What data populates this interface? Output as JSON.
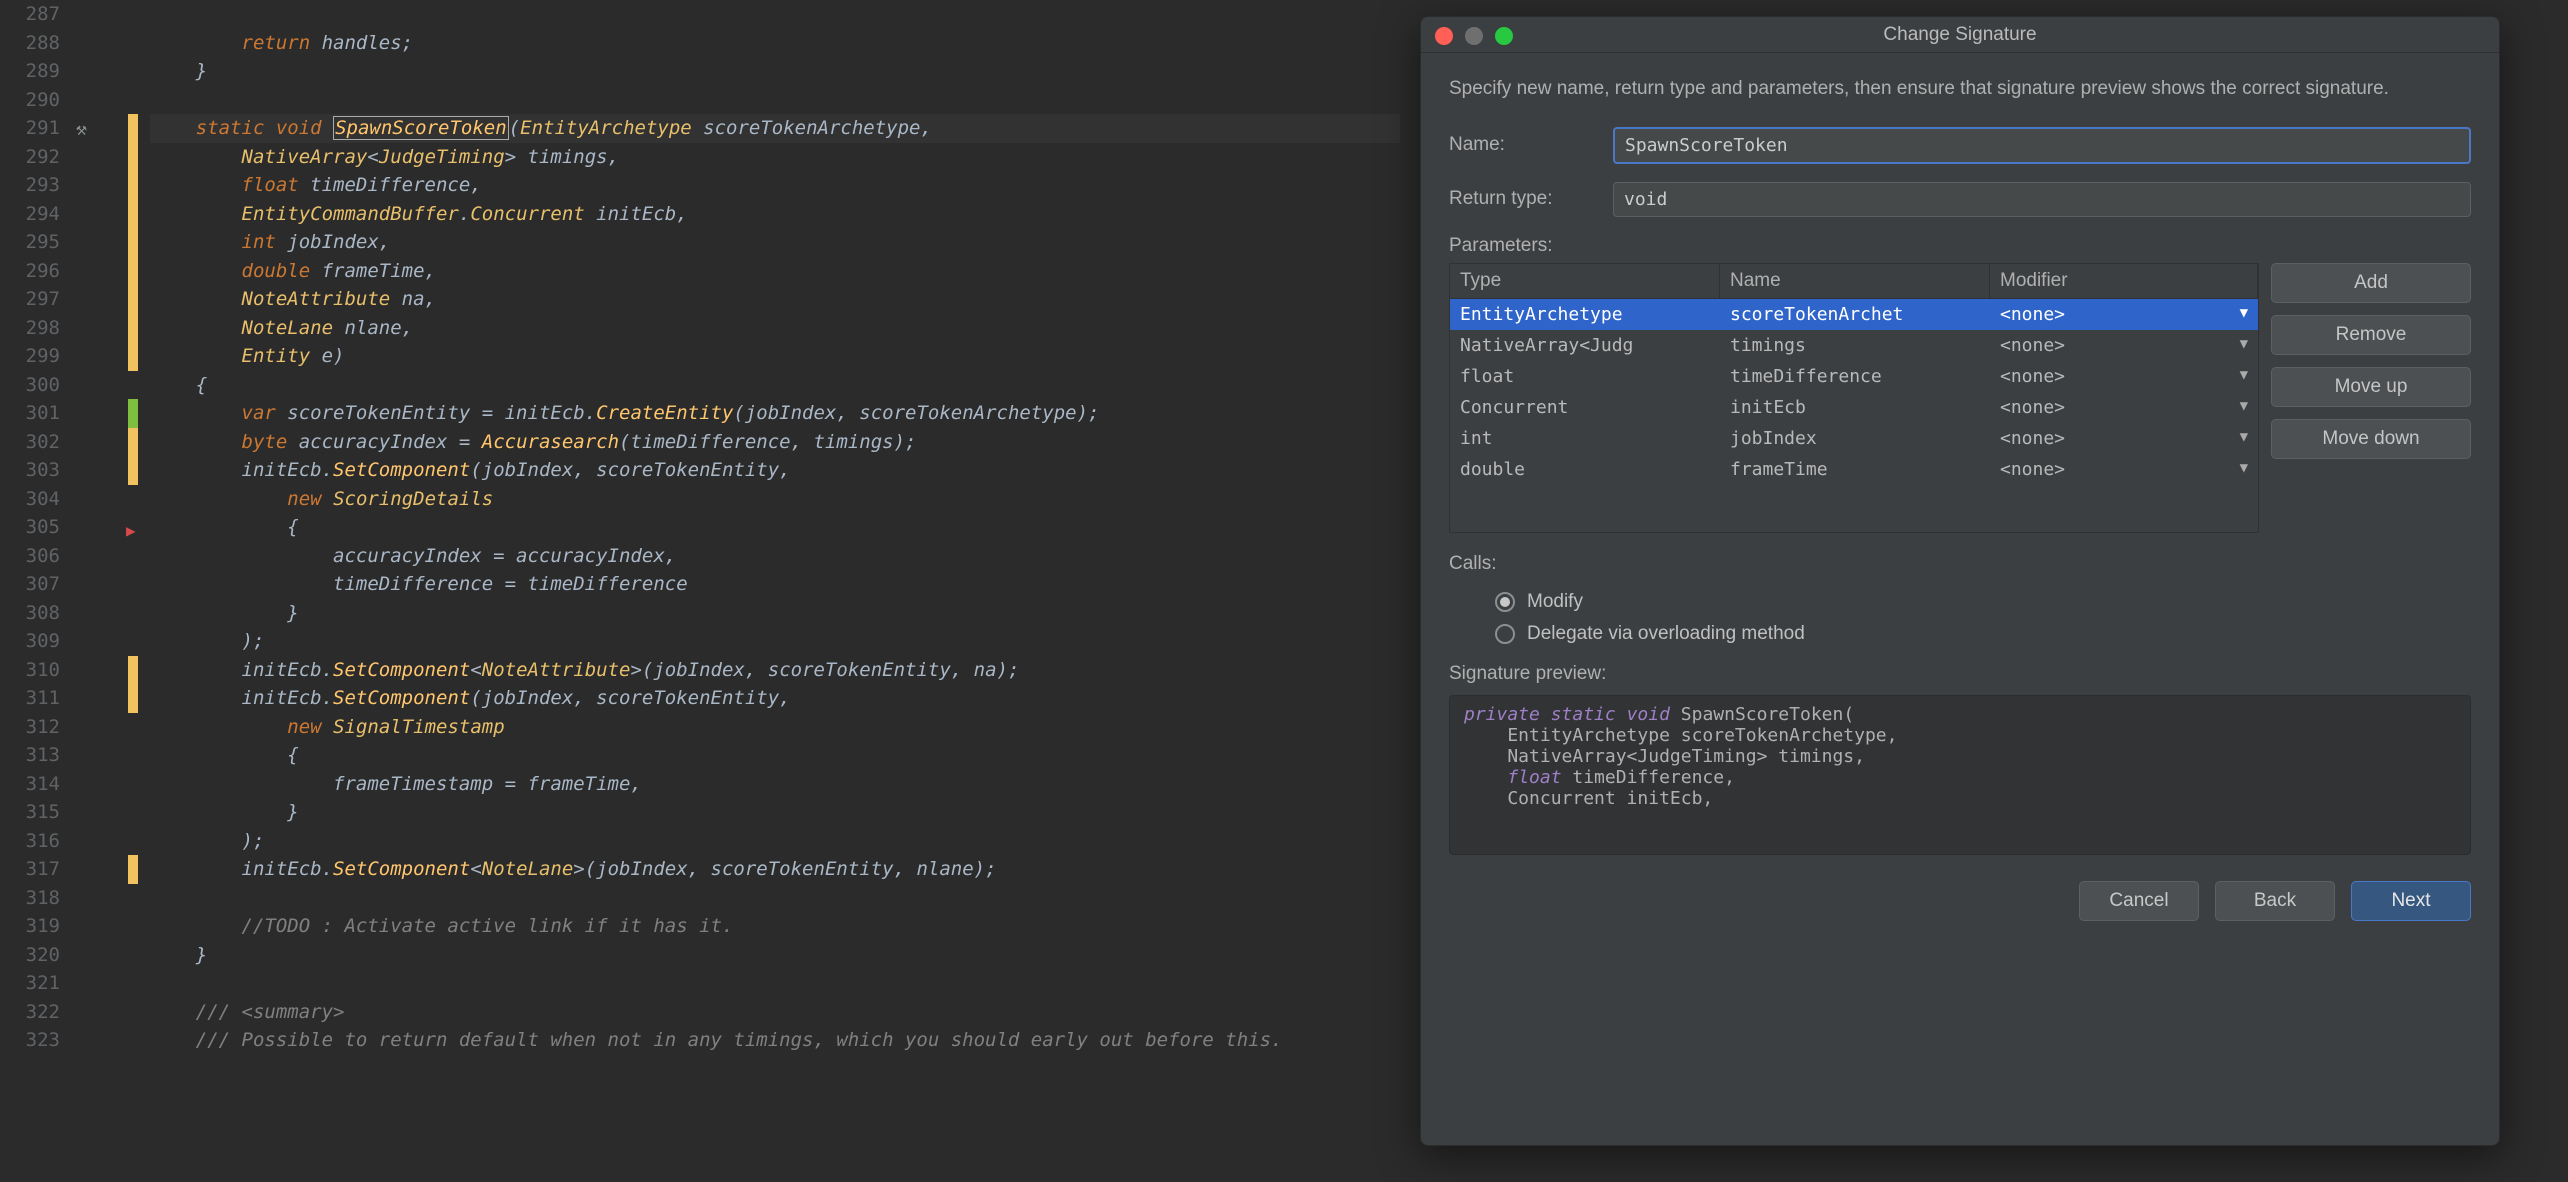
{
  "editor": {
    "first_line": 287,
    "lines": [
      "",
      "        return handles;",
      "    }",
      "",
      "    static void SpawnScoreToken(EntityArchetype scoreTokenArchetype,",
      "        NativeArray<JudgeTiming> timings,",
      "        float timeDifference,",
      "        EntityCommandBuffer.Concurrent initEcb,",
      "        int jobIndex,",
      "        double frameTime,",
      "        NoteAttribute na,",
      "        NoteLane nlane,",
      "        Entity e)",
      "    {",
      "        var scoreTokenEntity = initEcb.CreateEntity(jobIndex, scoreTokenArchetype);",
      "        byte accuracyIndex = Accurasearch(timeDifference, timings);",
      "        initEcb.SetComponent(jobIndex, scoreTokenEntity,",
      "            new ScoringDetails",
      "            {",
      "                accuracyIndex = accuracyIndex,",
      "                timeDifference = timeDifference",
      "            }",
      "        );",
      "        initEcb.SetComponent<NoteAttribute>(jobIndex, scoreTokenEntity, na);",
      "        initEcb.SetComponent(jobIndex, scoreTokenEntity,",
      "            new SignalTimestamp",
      "            {",
      "                frameTimestamp = frameTime,",
      "            }",
      "        );",
      "        initEcb.SetComponent<NoteLane>(jobIndex, scoreTokenEntity, nlane);",
      "",
      "        //TODO : Activate active link if it has it.",
      "    }",
      "",
      "    /// <summary>",
      "    /// Possible to return default when not in any timings, which you should early out before this."
    ],
    "yellow_markers_at": [
      291,
      292,
      293,
      294,
      295,
      296,
      297,
      298,
      299,
      302,
      303,
      310,
      311,
      317
    ],
    "green_markers_at": [
      301
    ],
    "hammer_at": 291,
    "break_icon_at": 305,
    "highlight_line": 291
  },
  "dialog": {
    "title": "Change Signature",
    "intro": "Specify new name, return type and parameters, then ensure that signature preview shows the correct signature.",
    "name_label": "Name:",
    "name_value": "SpawnScoreToken",
    "return_label": "Return type:",
    "return_value": "void",
    "parameters_label": "Parameters:",
    "columns": {
      "type": "Type",
      "name": "Name",
      "modifier": "Modifier"
    },
    "rows": [
      {
        "type": "EntityArchetype",
        "name": "scoreTokenArchet",
        "mod": "<none>"
      },
      {
        "type": "NativeArray<Judg",
        "name": "timings",
        "mod": "<none>"
      },
      {
        "type": "float",
        "name": "timeDifference",
        "mod": "<none>"
      },
      {
        "type": "Concurrent",
        "name": "initEcb",
        "mod": "<none>"
      },
      {
        "type": "int",
        "name": "jobIndex",
        "mod": "<none>"
      },
      {
        "type": "double",
        "name": "frameTime",
        "mod": "<none>"
      }
    ],
    "selected_row": 0,
    "buttons": {
      "add": "Add",
      "remove": "Remove",
      "moveup": "Move up",
      "movedown": "Move down"
    },
    "calls_label": "Calls:",
    "radio_modify": "Modify",
    "radio_delegate": "Delegate via overloading method",
    "radio_selected": "modify",
    "preview_label": "Signature preview:",
    "preview_lines": [
      "private static void SpawnScoreToken(",
      "    EntityArchetype scoreTokenArchetype,",
      "    NativeArray<JudgeTiming> timings,",
      "    float timeDifference,",
      "    Concurrent initEcb,"
    ],
    "footer": {
      "cancel": "Cancel",
      "back": "Back",
      "next": "Next"
    }
  }
}
